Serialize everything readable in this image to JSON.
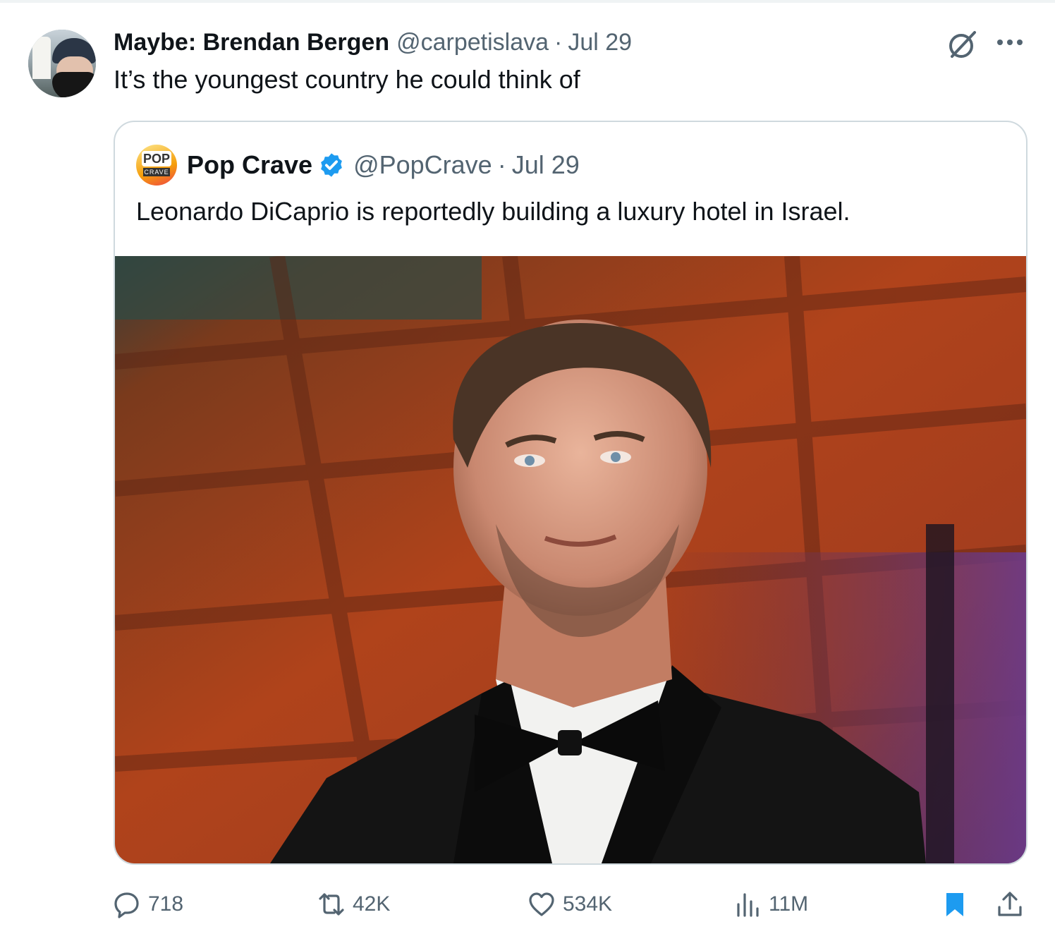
{
  "tweet": {
    "author_name": "Maybe: Brendan Bergen",
    "author_handle": "@carpetislava",
    "separator": "·",
    "date": "Jul 29",
    "text": "It’s the youngest country he could think of"
  },
  "quoted_tweet": {
    "author_name": "Pop Crave",
    "author_handle": "@PopCrave",
    "separator": "·",
    "date": "Jul 29",
    "text": "Leonardo DiCaprio is reportedly building a luxury hotel in Israel.",
    "avatar_logo_top": "POP",
    "avatar_logo_bottom": "CRAVE",
    "verified": true
  },
  "actions": {
    "replies": "718",
    "retweets": "42K",
    "likes": "534K",
    "views": "11M",
    "bookmarked": true
  },
  "colors": {
    "text_primary": "#0f1419",
    "text_secondary": "#536471",
    "verified_blue": "#1d9bf0",
    "border": "#cfd9de"
  },
  "icons": [
    "grok-icon",
    "more-icon",
    "verified-badge-icon",
    "reply-icon",
    "retweet-icon",
    "like-icon",
    "views-icon",
    "bookmark-icon",
    "share-icon"
  ]
}
